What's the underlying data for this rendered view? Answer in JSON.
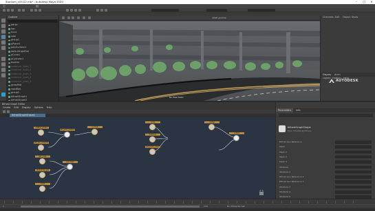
{
  "window": {
    "title": "Stadium_v05.02.mb* - Autodesk Maya 2020",
    "minimize": "–",
    "maximize": "□",
    "close": "✕"
  },
  "outliner": {
    "title": "Outliner",
    "items": [
      {
        "label": "persp",
        "grey": false
      },
      {
        "label": "top",
        "grey": false
      },
      {
        "label": "front",
        "grey": false
      },
      {
        "label": "side",
        "grey": false
      },
      {
        "label": "group1",
        "grey": false
      },
      {
        "label": "pPlane1",
        "grey": false
      },
      {
        "label": "polySurface1",
        "grey": false
      },
      {
        "label": "defaultLightSet",
        "grey": false
      },
      {
        "label": "pCone1",
        "grey": false
      },
      {
        "label": "pCylinder1",
        "grey": false
      },
      {
        "label": "bushes",
        "grey": false
      },
      {
        "label": "instancer_bush_1",
        "grey": true
      },
      {
        "label": "instancer_bush_2",
        "grey": true
      },
      {
        "label": "instancer_bush_3",
        "grey": true
      },
      {
        "label": "instancer_bush_4",
        "grey": true
      },
      {
        "label": "instancer_bush_5",
        "grey": true
      },
      {
        "label": "grassMat",
        "grey": false
      },
      {
        "label": "roadMat",
        "grey": false
      },
      {
        "label": "group2",
        "grey": false
      },
      {
        "label": "bifrostGraph1",
        "grey": false
      },
      {
        "label": "bifrostGraph2",
        "grey": false
      }
    ]
  },
  "viewport": {
    "toolbar_label": "sRGB gamma",
    "footer_label": "No Pixel Ratio"
  },
  "channel_box": {
    "tabs": [
      "Channels",
      "Edit",
      "Object",
      "Show"
    ],
    "layer_tabs": [
      "Display",
      "Anim"
    ],
    "layer_menus": [
      "Layers",
      "Options",
      "Help"
    ],
    "brand": "AUTODESK"
  },
  "bifrost_graph_editor": {
    "title": "Bifrost Graph Editor",
    "menus": [
      "Create",
      "Edit",
      "Display",
      "Options",
      "Help"
    ],
    "graph_name": "bifrostGraphShape1",
    "nodes": [
      {
        "label": "scatter_points"
      },
      {
        "label": "get_geo_property"
      },
      {
        "label": "get_point_position"
      },
      {
        "label": "to_float"
      },
      {
        "label": "get_scale"
      },
      {
        "label": "randomize_geo"
      },
      {
        "label": "set_mesh"
      },
      {
        "label": "input"
      },
      {
        "label": "noise"
      },
      {
        "label": "instance"
      },
      {
        "label": "set_point_orient"
      },
      {
        "label": "output"
      },
      {
        "label": "merge"
      }
    ]
  },
  "attribute_editor": {
    "tabs": [
      "Parameters",
      "Info"
    ],
    "node_name": "bifrostGraphShape",
    "node_type": "Type: bifrostGraphShape",
    "attributes": [
      "Bifrost Geo Reference",
      "Mesh",
      "Mesh 2",
      "Mesh 3",
      "Mesh 4",
      "Obstacle",
      "Obstacle 2",
      "Bifrost Geo Reference 2",
      "Bifrost Geo Reference 3",
      "Obstacle 3",
      "Obstacle 4",
      "Obstacle 5"
    ]
  },
  "timeline": {
    "start": "1",
    "end": "120",
    "character_set": "No Character Set"
  },
  "colors": {
    "accent": "#4a6e8a",
    "node_header": "#b98a3a",
    "graph_bg": "#2a3443"
  }
}
